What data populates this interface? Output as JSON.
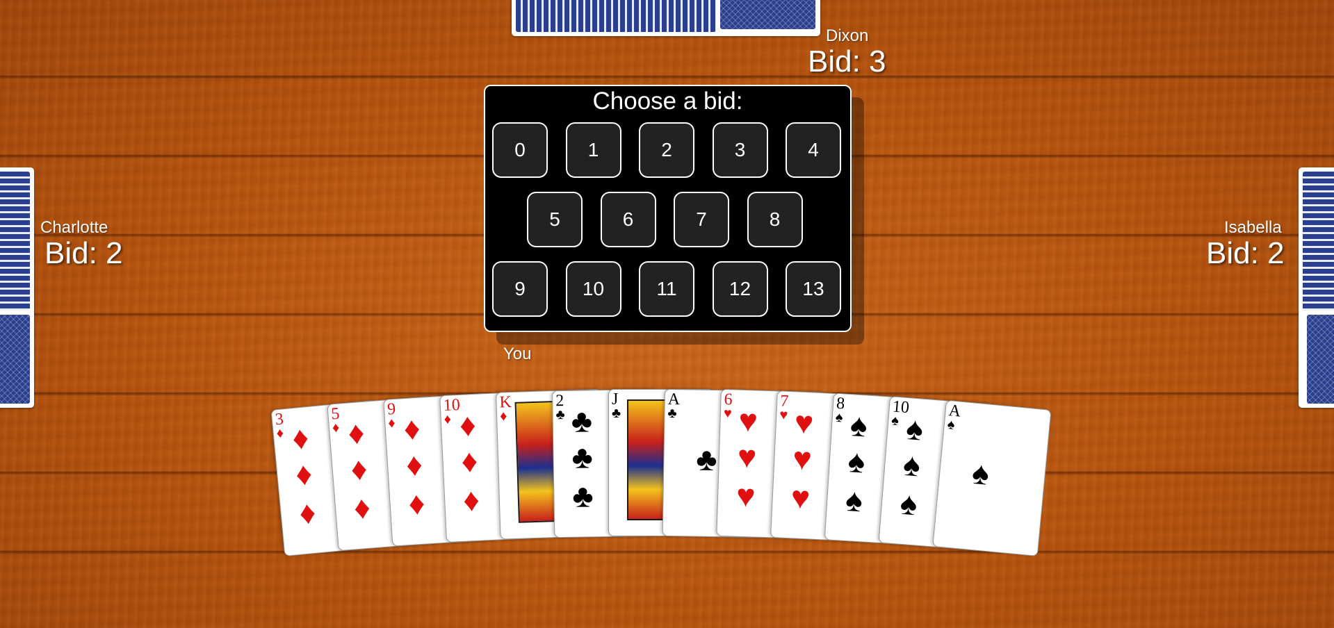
{
  "players": {
    "top": {
      "name": "Dixon",
      "bid": "Bid: 3"
    },
    "left": {
      "name": "Charlotte",
      "bid": "Bid: 2"
    },
    "right": {
      "name": "Isabella",
      "bid": "Bid: 2"
    },
    "you": {
      "name": "You"
    }
  },
  "bid_panel": {
    "title": "Choose a bid:",
    "options": [
      "0",
      "1",
      "2",
      "3",
      "4",
      "5",
      "6",
      "7",
      "8",
      "9",
      "10",
      "11",
      "12",
      "13"
    ]
  },
  "hand": [
    {
      "rank": "3",
      "suit": "♦",
      "color": "red"
    },
    {
      "rank": "5",
      "suit": "♦",
      "color": "red"
    },
    {
      "rank": "9",
      "suit": "♦",
      "color": "red"
    },
    {
      "rank": "10",
      "suit": "♦",
      "color": "red"
    },
    {
      "rank": "K",
      "suit": "♦",
      "color": "red"
    },
    {
      "rank": "2",
      "suit": "♣",
      "color": "black"
    },
    {
      "rank": "J",
      "suit": "♣",
      "color": "black"
    },
    {
      "rank": "A",
      "suit": "♣",
      "color": "black"
    },
    {
      "rank": "6",
      "suit": "♥",
      "color": "red"
    },
    {
      "rank": "7",
      "suit": "♥",
      "color": "red"
    },
    {
      "rank": "8",
      "suit": "♠",
      "color": "black"
    },
    {
      "rank": "10",
      "suit": "♠",
      "color": "black"
    },
    {
      "rank": "A",
      "suit": "♠",
      "color": "black"
    }
  ],
  "colors": {
    "table": "#b3530f",
    "card_back": "#2a3f8f",
    "red_suit": "#e01010"
  }
}
